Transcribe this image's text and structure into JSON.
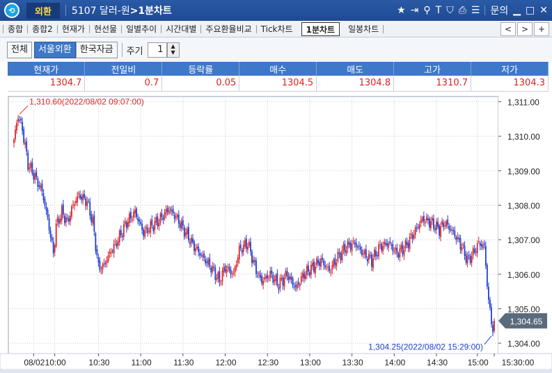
{
  "window": {
    "logo": "⟲",
    "section": "외환",
    "code_title": "5107 달러-원",
    "title_suffix": ">1분차트",
    "icons": [
      "star-icon",
      "export-icon",
      "link-icon",
      "text-icon",
      "shield-icon",
      "print-icon",
      "list-icon"
    ],
    "help": "문의"
  },
  "tabs": [
    "종합",
    "종합2",
    "현재가",
    "현선물",
    "일별추이",
    "시간대별",
    "주요환율비교",
    "Tick차트",
    "1분차트",
    "일봉차트"
  ],
  "active_tab": "1분차트",
  "tab_nav": [
    "<",
    ">",
    "+"
  ],
  "toolbar": {
    "buttons": [
      "전체",
      "서울외환",
      "한국자금"
    ],
    "active_button": "서울외환",
    "period_label": "주기",
    "period_value": "1"
  },
  "quote": {
    "headers": [
      "현재가",
      "전일비",
      "등락률",
      "매수",
      "매도",
      "고가",
      "저가"
    ],
    "values": [
      "1304.7",
      "0.7",
      "0.05",
      "1304.5",
      "1304.8",
      "1310.7",
      "1304.3"
    ]
  },
  "chart_data": {
    "type": "candlestick",
    "x_tick_labels": [
      "08/02",
      "10:00",
      "10:30",
      "11:00",
      "11:30",
      "12:00",
      "12:30",
      "13:00",
      "13:30",
      "14:00",
      "14:30",
      "15:00",
      "15:30:00"
    ],
    "y_tick_labels": [
      "1,311.00",
      "1,310.00",
      "1,309.00",
      "1,308.00",
      "1,307.00",
      "1,306.00",
      "1,305.00",
      "1,304.00"
    ],
    "ylim": [
      1303.7,
      1311.15
    ],
    "current_price_label": "1,304.65",
    "current_price": 1304.65,
    "high_annotation": "1,310.60(2022/08/02 09:07:00)",
    "low_annotation": "1,304.25(2022/08/02 15:29:00)",
    "high": 1310.6,
    "low": 1304.25,
    "up_color": "#d9262a",
    "down_color": "#1f3fd0",
    "grid": true,
    "anchors": [
      [
        0,
        1309.9
      ],
      [
        3,
        1310.6
      ],
      [
        6,
        1310.2
      ],
      [
        10,
        1309.2
      ],
      [
        14,
        1308.9
      ],
      [
        20,
        1308.4
      ],
      [
        24,
        1307.6
      ],
      [
        28,
        1306.6
      ],
      [
        30,
        1307.4
      ],
      [
        34,
        1307.8
      ],
      [
        38,
        1307.5
      ],
      [
        42,
        1308.0
      ],
      [
        46,
        1308.3
      ],
      [
        52,
        1308.1
      ],
      [
        56,
        1307.5
      ],
      [
        60,
        1306.2
      ],
      [
        63,
        1306.2
      ],
      [
        68,
        1306.6
      ],
      [
        74,
        1307.0
      ],
      [
        80,
        1307.5
      ],
      [
        86,
        1307.8
      ],
      [
        92,
        1307.2
      ],
      [
        98,
        1307.4
      ],
      [
        104,
        1307.6
      ],
      [
        110,
        1307.9
      ],
      [
        116,
        1307.6
      ],
      [
        122,
        1307.2
      ],
      [
        128,
        1306.8
      ],
      [
        134,
        1306.5
      ],
      [
        140,
        1306.2
      ],
      [
        146,
        1305.8
      ],
      [
        150,
        1306.2
      ],
      [
        156,
        1306.0
      ],
      [
        160,
        1306.7
      ],
      [
        166,
        1306.9
      ],
      [
        172,
        1306.1
      ],
      [
        176,
        1305.8
      ],
      [
        182,
        1306.0
      ],
      [
        188,
        1305.7
      ],
      [
        194,
        1306.0
      ],
      [
        200,
        1305.6
      ],
      [
        206,
        1306.0
      ],
      [
        212,
        1306.2
      ],
      [
        218,
        1306.4
      ],
      [
        224,
        1306.1
      ],
      [
        230,
        1306.5
      ],
      [
        236,
        1306.8
      ],
      [
        242,
        1306.9
      ],
      [
        248,
        1306.6
      ],
      [
        254,
        1306.4
      ],
      [
        260,
        1306.8
      ],
      [
        266,
        1306.9
      ],
      [
        272,
        1306.6
      ],
      [
        278,
        1306.8
      ],
      [
        284,
        1307.2
      ],
      [
        290,
        1307.6
      ],
      [
        296,
        1307.5
      ],
      [
        302,
        1307.3
      ],
      [
        306,
        1307.5
      ],
      [
        312,
        1307.2
      ],
      [
        318,
        1306.8
      ],
      [
        322,
        1306.4
      ],
      [
        326,
        1306.6
      ],
      [
        330,
        1306.9
      ],
      [
        334,
        1306.8
      ],
      [
        337,
        1305.2
      ],
      [
        340,
        1304.4
      ],
      [
        341,
        1304.65
      ]
    ]
  }
}
